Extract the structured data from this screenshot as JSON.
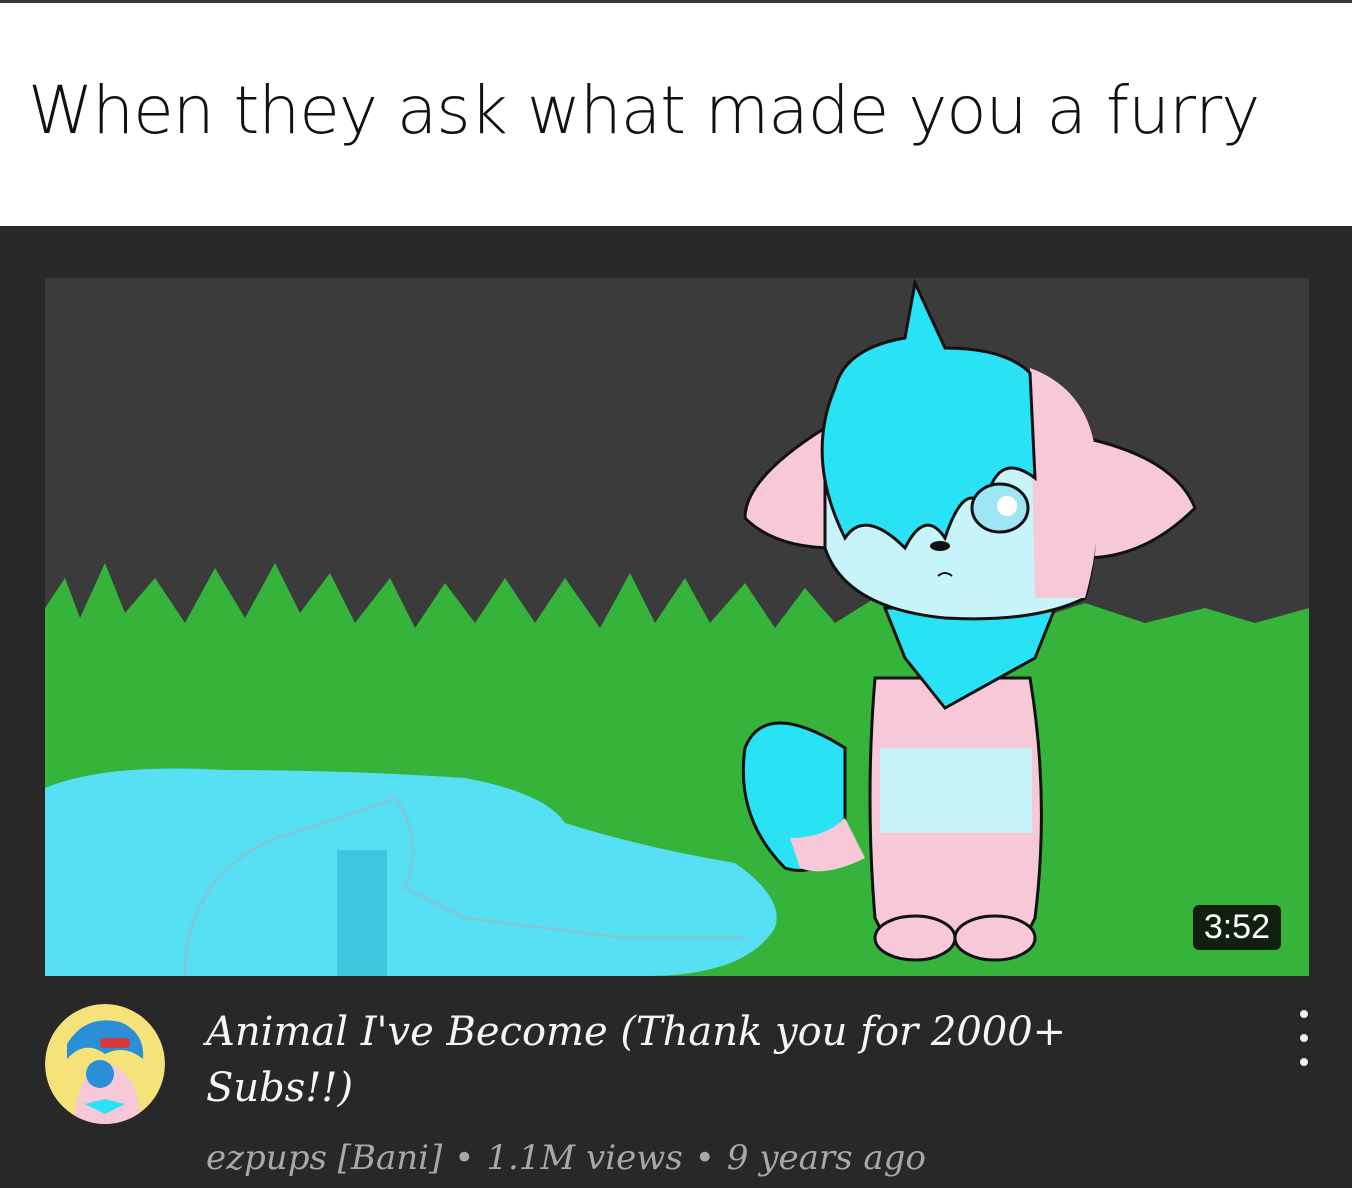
{
  "caption": "When they ask what made you a furry",
  "video": {
    "duration": "3:52",
    "title": "Animal I've Become (Thank you for 2000+ Subs!!)",
    "channel": "ezpups [Bani]",
    "views": "1.1M views",
    "age": "9 years ago",
    "separator": "•"
  },
  "icons": {
    "more": "more-vert-icon",
    "avatar": "channel-avatar"
  },
  "colors": {
    "card_bg": "#282828",
    "sky": "#3b3b3b",
    "grass": "#35b33a",
    "water": "#57dff3",
    "cyan_hair": "#29e2f6",
    "pink_fur": "#f6c8d8",
    "avatar_bg": "#f6e27a"
  }
}
